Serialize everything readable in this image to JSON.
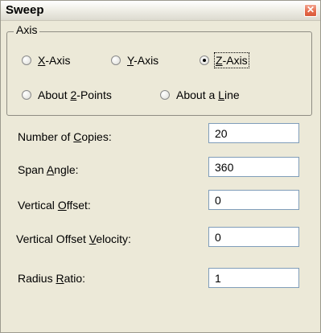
{
  "window": {
    "title": "Sweep",
    "close_glyph": "✕"
  },
  "axis_group": {
    "label": "Axis",
    "options": [
      {
        "pre": "",
        "key": "X",
        "post": "-Axis",
        "checked": false
      },
      {
        "pre": "",
        "key": "Y",
        "post": "-Axis",
        "checked": false
      },
      {
        "pre": "",
        "key": "Z",
        "post": "-Axis",
        "checked": true
      },
      {
        "pre": "About ",
        "key": "2",
        "post": "-Points",
        "checked": false
      },
      {
        "pre": "About a ",
        "key": "L",
        "post": "ine",
        "checked": false
      }
    ]
  },
  "fields": [
    {
      "label_pre": "Number of ",
      "label_key": "C",
      "label_post": "opies:",
      "value": "20"
    },
    {
      "label_pre": "Span ",
      "label_key": "A",
      "label_post": "ngle:",
      "value": "360"
    },
    {
      "label_pre": "Vertical ",
      "label_key": "O",
      "label_post": "ffset:",
      "value": "0"
    },
    {
      "label_pre": "Vertical Offset ",
      "label_key": "V",
      "label_post": "elocity:",
      "value": "0"
    },
    {
      "label_pre": "Radius ",
      "label_key": "R",
      "label_post": "atio:",
      "value": "1"
    }
  ]
}
